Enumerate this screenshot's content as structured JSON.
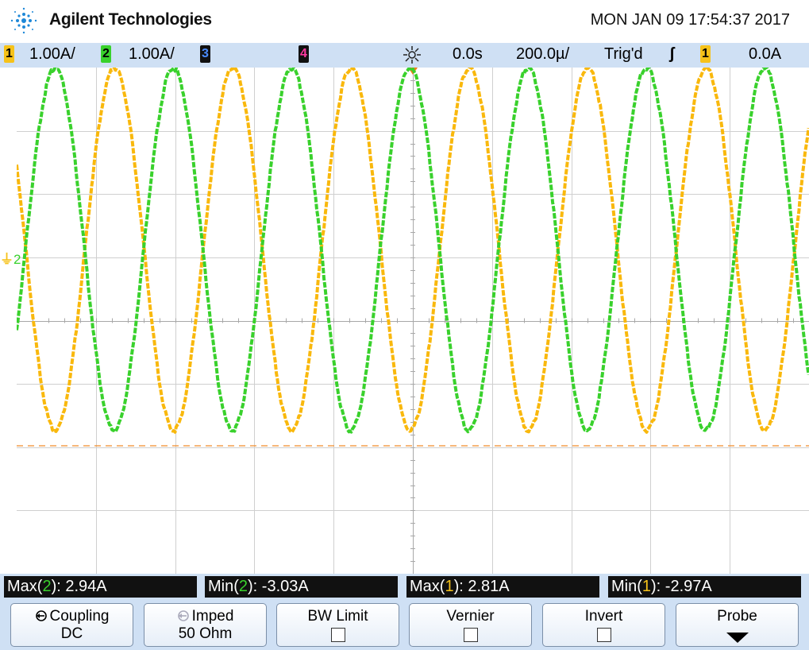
{
  "header": {
    "brand": "Agilent Technologies",
    "datetime": "MON JAN 09 17:54:37 2017",
    "logo_icon": "agilent-spark-logo"
  },
  "status": {
    "ch1": {
      "num": "1",
      "scale": "1.00A/",
      "color": "#f6c21a"
    },
    "ch2": {
      "num": "2",
      "scale": "1.00A/",
      "color": "#39d12c"
    },
    "ch3": {
      "num": "3",
      "color": "#2f6fe0"
    },
    "ch4": {
      "num": "4",
      "color": "#e2157a"
    },
    "trigger_icon": "trigger-sun-icon",
    "delay": "0.0s",
    "timebase": "200.0µ/",
    "trig_status": "Trig'd",
    "trig_edge": "ʃ",
    "trig_source": "1",
    "trig_level": "0.0A"
  },
  "waveform": {
    "ground_marker": "2",
    "traces": [
      {
        "name": "channel-1",
        "color": "#f9b80c",
        "amplitude_A": 2.81,
        "period_ms": 0.29
      },
      {
        "name": "channel-2",
        "color": "#39d12c",
        "amplitude_A": 2.94,
        "period_ms": 0.29
      }
    ]
  },
  "measurements": [
    {
      "pre": "Max(",
      "ch": "2",
      "post": "): 2.94A",
      "color": "#39d12c"
    },
    {
      "pre": "Min(",
      "ch": "2",
      "post": "): -3.03A",
      "color": "#39d12c"
    },
    {
      "pre": "Max(",
      "ch": "1",
      "post": "): 2.81A",
      "color": "#f6c21a"
    },
    {
      "pre": "Min(",
      "ch": "1",
      "post": "): -2.97A",
      "color": "#f6c21a"
    }
  ],
  "softkeys": [
    {
      "label": "Coupling",
      "value": "DC",
      "icon": "rotate-arrow-icon"
    },
    {
      "label": "Imped",
      "value": "50 Ohm",
      "icon": "rotate-arrow-icon"
    },
    {
      "label": "BW Limit",
      "checked": false
    },
    {
      "label": "Vernier",
      "checked": false
    },
    {
      "label": "Invert",
      "checked": false
    },
    {
      "label": "Probe",
      "icon": "down-arrow-icon"
    }
  ]
}
